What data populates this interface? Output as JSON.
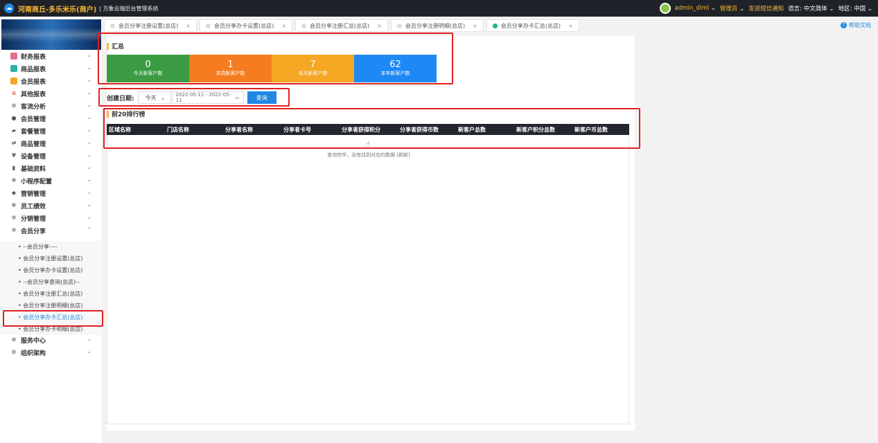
{
  "topbar": {
    "brand": "河南商丘-多乐米乐(商户)",
    "system_name": "| 万象云端后台管理系统",
    "user": "admin_dlml",
    "role": "管理员",
    "sms": "发送短信通知",
    "lang_label": "语言:",
    "lang_value": "中文简体",
    "region_label": "地区:",
    "region_value": "中国",
    "chevron": "⌄"
  },
  "tabs": [
    {
      "label": "会员分享注册设置(总店)"
    },
    {
      "label": "会员分享办卡设置(总店)"
    },
    {
      "label": "会员分享注册汇总(总店)"
    },
    {
      "label": "会员分享注册明细(总店)"
    },
    {
      "label": "会员分享办卡汇总(总店)"
    }
  ],
  "help": "帮助文档",
  "sidebar": {
    "menus": [
      "财务报表",
      "商品报表",
      "会员报表",
      "其他报表",
      "客流分析",
      "会员管理",
      "套餐管理",
      "商品管理",
      "设备管理",
      "基础资料",
      "小程序配置",
      "营销管理",
      "员工绩效",
      "分销管理",
      "会员分享"
    ],
    "submenus": [
      "• --会员分享----",
      "• 会员分享注册设置(总店)",
      "• 会员分享办卡设置(总店)",
      "• --会员分享查询(总店)--",
      "• 会员分享注册汇总(总店)",
      "• 会员分享注册明细(总店)",
      "• 会员分享办卡汇总(总店)",
      "• 会员分享办卡明细(总店)"
    ],
    "bottom_menus": [
      "服务中心",
      "组织架构"
    ],
    "colors": {
      "active": "#1e88e5"
    }
  },
  "summary": {
    "title": "汇总",
    "stats": [
      {
        "value": "0",
        "label": "今天新客户数",
        "color": "#3a9b43"
      },
      {
        "value": "1",
        "label": "本周新客户数",
        "color": "#f57c1f"
      },
      {
        "value": "7",
        "label": "本月新客户数",
        "color": "#f5a623"
      },
      {
        "value": "62",
        "label": "本年新客户数",
        "color": "#1e88f5"
      }
    ]
  },
  "filter": {
    "label": "创建日期:",
    "range": "今天",
    "date_range": "2022-05-11 - 2022-05-11",
    "query": "查询",
    "calendar_icon": "▭"
  },
  "ranking": {
    "title": "前20排行榜",
    "columns": [
      "区域名称",
      "门店名称",
      "分享者名称",
      "分享者卡号",
      "分享者获得积分",
      "分享者获得币数",
      "新客户总数",
      "新客户积分总数",
      "新客户币总数"
    ],
    "hand_icon": "☝",
    "empty_text": "查询完毕，没有找到对应的数据 [刷新]"
  }
}
